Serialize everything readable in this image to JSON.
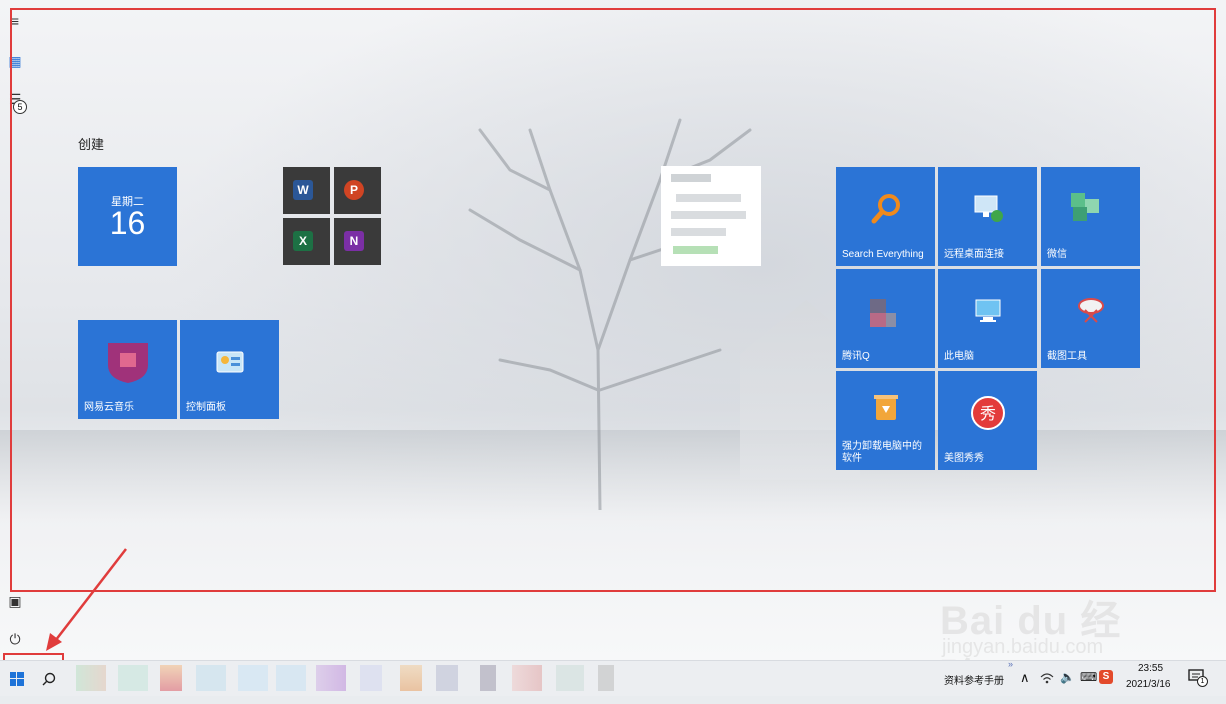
{
  "start_menu": {
    "group_title": "创建",
    "calendar": {
      "day": "星期二",
      "date": "16"
    },
    "office_apps": [
      {
        "name": "word-icon",
        "letter": "W",
        "color": "#2b5797"
      },
      {
        "name": "powerpoint-icon",
        "letter": "P",
        "color": "#d04423"
      },
      {
        "name": "excel-icon",
        "letter": "X",
        "color": "#1d7044"
      },
      {
        "name": "onenote-icon",
        "letter": "N",
        "color": "#7b2fa5"
      }
    ],
    "tiles": {
      "netease_music": "网易云音乐",
      "control_panel": "控制面板",
      "search_everything": "Search Everything",
      "remote_desktop": "远程桌面连接",
      "wechat": "微信",
      "tencent_qq": "腾讯Q",
      "this_pc": "此电脑",
      "screenshot_tool": "截图工具",
      "uninstaller": "强力卸载电脑中的软件",
      "meitu": "美图秀秀"
    },
    "rail_badge": "5"
  },
  "taskbar": {
    "search_label": "资料参考手册",
    "time": "23:55",
    "date": "2021/3/16",
    "notification_count": "1",
    "chevron": "»"
  },
  "watermark": {
    "line1": "Bai du 经验",
    "line2": "jingyan.baidu.com"
  },
  "colors": {
    "tile_blue": "#2b74d6",
    "highlight_red": "#e03c3c"
  }
}
